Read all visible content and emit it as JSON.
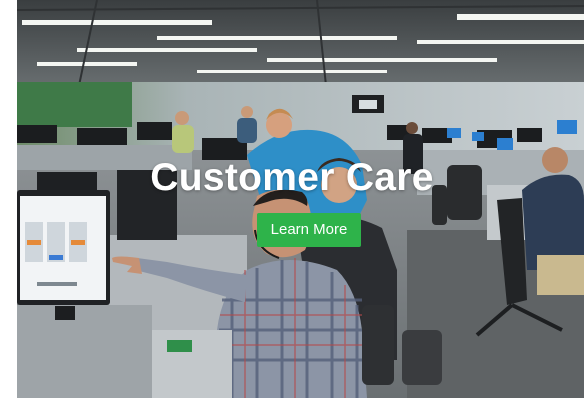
{
  "hero": {
    "heading": "Customer Care",
    "cta_label": "Learn More",
    "image_subject": "office-call-center-photo"
  },
  "colors": {
    "cta_background": "#2eb34a",
    "heading_text": "#ffffff"
  }
}
